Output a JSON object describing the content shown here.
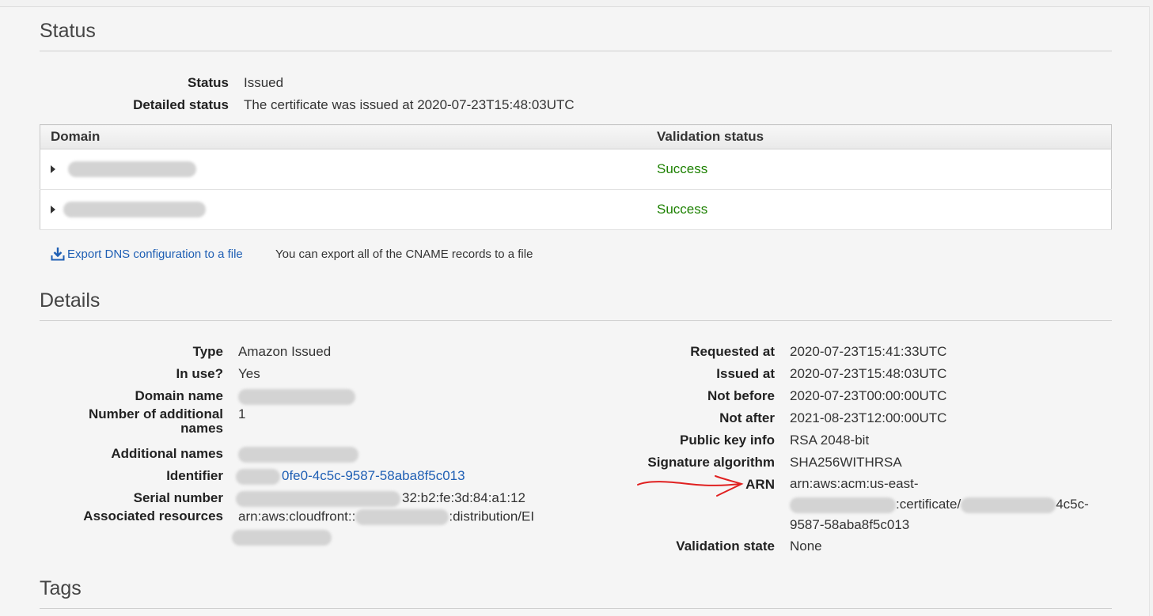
{
  "status_section": {
    "title": "Status",
    "status_label": "Status",
    "status_value": "Issued",
    "detailed_label": "Detailed status",
    "detailed_value": "The certificate was issued at 2020-07-23T15:48:03UTC",
    "table": {
      "columns": [
        "Domain",
        "Validation status"
      ],
      "rows": [
        {
          "domain": "",
          "validation": "Success"
        },
        {
          "domain": "",
          "validation": "Success"
        }
      ]
    },
    "export_link": "Export DNS configuration to a file",
    "export_hint": "You can export all of the CNAME records to a file"
  },
  "details_section": {
    "title": "Details",
    "left": {
      "type_label": "Type",
      "type_value": "Amazon Issued",
      "inuse_label": "In use?",
      "inuse_value": "Yes",
      "domain_label": "Domain name",
      "addl_count_label": "Number of additional names",
      "addl_count_value": "1",
      "addl_names_label": "Additional names",
      "identifier_label": "Identifier",
      "identifier_value": "0fe0-4c5c-9587-58aba8f5c013",
      "serial_label": "Serial number",
      "serial_value": "32:b2:fe:3d:84:a1:12",
      "assoc_label": "Associated resources",
      "assoc_value_a": "arn:aws:cloudfront::",
      "assoc_value_b": ":distribution/EI"
    },
    "right": {
      "requested_label": "Requested at",
      "requested_value": "2020-07-23T15:41:33UTC",
      "issued_label": "Issued at",
      "issued_value": "2020-07-23T15:48:03UTC",
      "notbefore_label": "Not before",
      "notbefore_value": "2020-07-23T00:00:00UTC",
      "notafter_label": "Not after",
      "notafter_value": "2021-08-23T12:00:00UTC",
      "pubkey_label": "Public key info",
      "pubkey_value": "RSA 2048-bit",
      "sigalg_label": "Signature algorithm",
      "sigalg_value": "SHA256WITHRSA",
      "arn_label": "ARN",
      "arn_line1": "arn:aws:acm:us-east-",
      "arn_line2a": ":certificate/",
      "arn_line2b": "4c5c-",
      "arn_line3": "9587-58aba8f5c013",
      "validation_label": "Validation state",
      "validation_value": "None"
    }
  },
  "tags_section": {
    "title": "Tags"
  },
  "colors": {
    "success": "#1d8102",
    "link": "#1f5fb4",
    "annotation": "#e02020"
  }
}
